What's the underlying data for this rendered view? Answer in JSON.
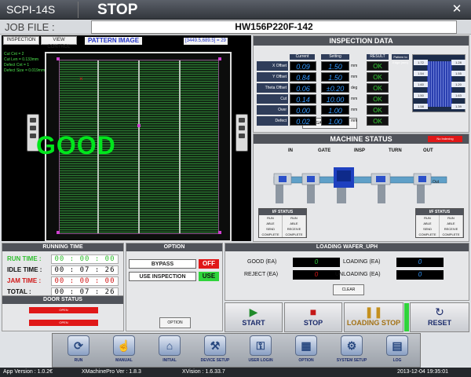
{
  "title_bar": {
    "app_name": "SCPI-14S",
    "status": "STOP",
    "close_symbol": "✕"
  },
  "job_file": {
    "label": "JOB FILE :",
    "value": "HW156P220F-142"
  },
  "inspection_image": {
    "tabs": [
      "INSPECTION",
      "VIEW CONTROL"
    ],
    "title": "PATTERN IMAGE",
    "coordinates": "[3449.5,689.5] = 29",
    "stats": [
      "Cut Cnt = 2",
      "Cut Len = 0.133mm",
      "Defect Cnt = 1",
      "Defect Size = 0.019mm"
    ],
    "result": "GOOD"
  },
  "inspection_data": {
    "title": "INSPECTION DATA",
    "col_current": "Current",
    "col_setting": "Setting",
    "col_result": "RESULT",
    "col_edge": "Pattern to Edge (mm)",
    "rows": [
      {
        "label": "X Offset",
        "current": "0.09",
        "setting": "1.50",
        "unit": "mm",
        "result": "OK"
      },
      {
        "label": "Y Offset",
        "current": "0.84",
        "setting": "1.50",
        "unit": "mm",
        "result": "OK"
      },
      {
        "label": "Theta Offset",
        "current": "0.06",
        "setting": "±0.20",
        "unit": "deg",
        "result": "OK"
      },
      {
        "label": "Cut",
        "current": "0.14",
        "setting": "10.00",
        "unit": "mm",
        "result": "OK"
      },
      {
        "label": "Over",
        "current": "0.00",
        "setting": "1.00",
        "unit": "mm",
        "result": "OK"
      },
      {
        "label": "Defect",
        "current": "0.02",
        "setting": "1.00",
        "unit": "mm",
        "result": "OK"
      }
    ],
    "edge_values": [
      "1.72",
      "1.28",
      "1.54",
      "1.55",
      "1.60",
      "1.20",
      "1.50",
      "1.63",
      "1.58",
      "1.39"
    ],
    "gauge_button": "GAUGE Setting"
  },
  "machine_status": {
    "title": "MACHINE STATUS",
    "indexing": "No Indexing",
    "stations": [
      "IN",
      "GATE",
      "INSP",
      "TURN",
      "OUT"
    ],
    "out_label": "Out",
    "if_title": "I/F STATUS",
    "if_rows": [
      [
        "RUN",
        "RUN"
      ],
      [
        "ABLE",
        "ABLE"
      ],
      [
        "SEND",
        "RECEIVE"
      ],
      [
        "COMPLETE",
        "COMPLETE"
      ]
    ]
  },
  "running_time": {
    "title": "RUNNING TIME",
    "rows": [
      {
        "label": "RUN TIME :",
        "value": "00 : 00 : 00"
      },
      {
        "label": "IDLE TIME :",
        "value": "00 : 07 : 26"
      },
      {
        "label": "JAM TIME :",
        "value": "00 : 00 : 00"
      },
      {
        "label": "TOTAL :",
        "value": "00 : 07 : 26"
      }
    ]
  },
  "door_status": {
    "title": "DOOR STATUS",
    "doors": [
      "OPEN",
      "OPEN"
    ]
  },
  "option": {
    "title": "OPTION",
    "items": [
      {
        "name": "BYPASS",
        "state": "OFF"
      },
      {
        "name": "USE INSPECTION",
        "state": "USE"
      }
    ],
    "button": "OPTION"
  },
  "loading_uph": {
    "title": "LOADING WAFER_UPH",
    "good_label": "GOOD (EA)",
    "good_value": "0",
    "reject_label": "REJECT (EA)",
    "reject_value": "0",
    "loading_label": "LOADING (EA)",
    "loading_value": "0",
    "unloading_label": "UNLOADING (EA)",
    "unloading_value": "0",
    "clear_button": "CLEAR"
  },
  "actions": {
    "start": "START",
    "stop": "STOP",
    "loading_stop": "LOADING STOP",
    "reset": "RESET"
  },
  "nav": [
    "RUN",
    "MANUAL",
    "INITIAL",
    "DEVICE SETUP",
    "USER LOGIN",
    "OPTION",
    "SYSTEM SETUP",
    "LOG"
  ],
  "status_bar": {
    "app_version": "App Version : 1.0.2€",
    "xmachine_version": "XMachinePro Ver : 1.8.3",
    "xvision_version": "XVision : 1.6.33.7",
    "datetime": "2013-12-04  19:35:01"
  },
  "colors": {
    "good": "#00e61c",
    "ok": "#35d335",
    "alarm": "#e01818",
    "value_blue": "#3399ff",
    "use_green": "#2fd43b"
  }
}
